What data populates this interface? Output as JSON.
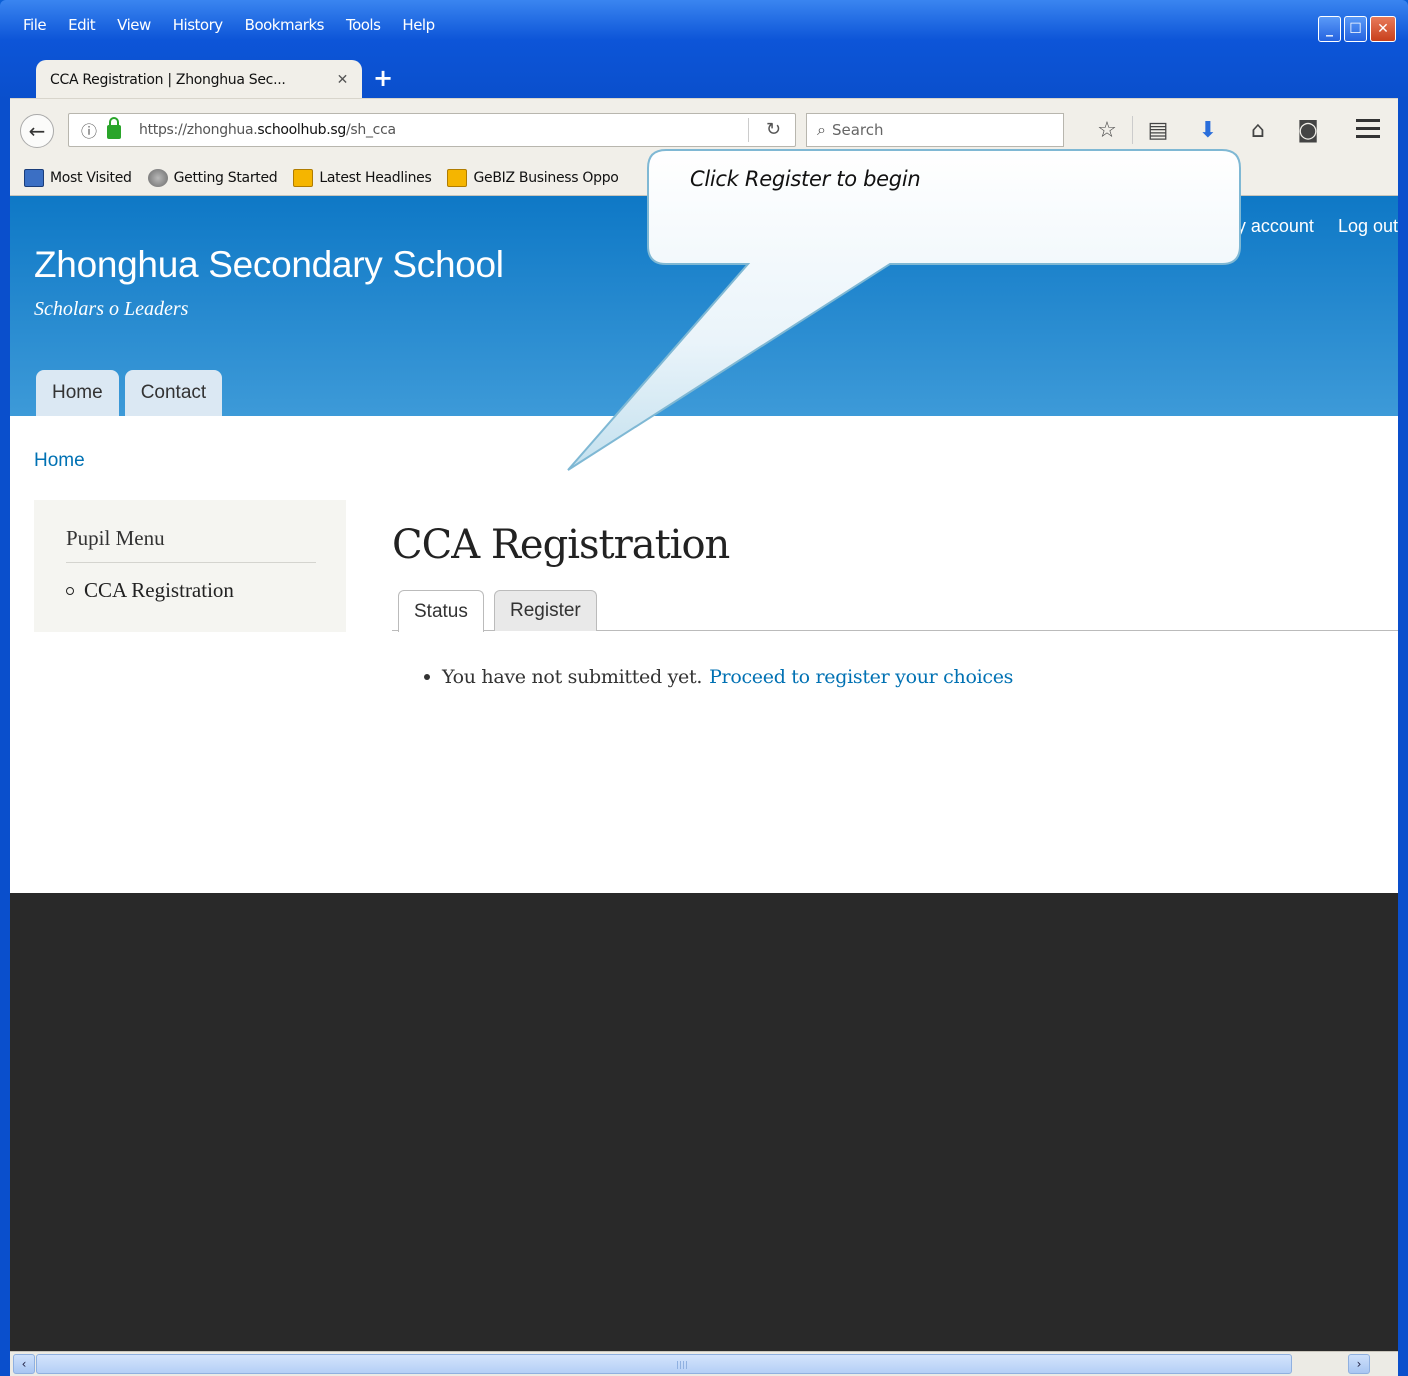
{
  "browser": {
    "menu": [
      "File",
      "Edit",
      "View",
      "History",
      "Bookmarks",
      "Tools",
      "Help"
    ],
    "tab_title": "CCA Registration | Zhonghua Sec...",
    "url_prefix": "https://zhonghua.",
    "url_domain": "schoolhub.sg",
    "url_path": "/sh_cca",
    "search_placeholder": "Search",
    "bookmarks": [
      "Most Visited",
      "Getting Started",
      "Latest Headlines",
      "GeBIZ Business Oppo"
    ]
  },
  "site": {
    "name": "Zhonghua Secondary School",
    "slogan": "Scholars o Leaders",
    "secondary_links": [
      "My account",
      "Log out"
    ],
    "nav": [
      "Home",
      "Contact"
    ],
    "breadcrumb": "Home"
  },
  "sidebar": {
    "title": "Pupil Menu",
    "items": [
      "CCA Registration"
    ]
  },
  "main": {
    "title": "CCA Registration",
    "tabs": [
      "Status",
      "Register"
    ],
    "message_text": "You have not submitted yet.",
    "message_link": "Proceed to register your choices"
  },
  "callout": {
    "text": "Click Register to begin"
  }
}
